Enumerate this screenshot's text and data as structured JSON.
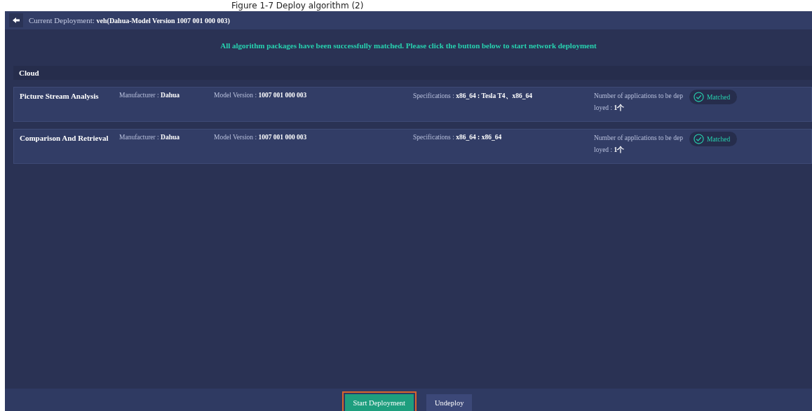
{
  "caption": "Figure 1-7 Deploy algorithm (2)",
  "header": {
    "label": "Current Deployment:",
    "value": "veh(Dahua-Model Version 1007 001 000 003)"
  },
  "message": "All algorithm packages have been successfully matched. Please click the button below to start network deployment",
  "section": {
    "title": "Cloud"
  },
  "rows": [
    {
      "name": "Picture Stream Analysis",
      "manufacturer_label": "Manufacturer :",
      "manufacturer": "Dahua",
      "model_label": "Model Version :",
      "model": "1007 001 000 003",
      "spec_label": "Specifications :",
      "spec": "x86_64 : Tesla T4、x86_64",
      "count_label": "Number of applications to be deployed :",
      "count": "1个",
      "status": "Matched",
      "matched": true
    },
    {
      "name": "Comparison And Retrieval",
      "manufacturer_label": "Manufacturer :",
      "manufacturer": "Dahua",
      "model_label": "Model Version :",
      "model": "1007 001 000 003",
      "spec_label": "Specifications :",
      "spec": "x86_64 : x86_64",
      "count_label": "Number of applications to be deployed :",
      "count": "1个",
      "status": "Matched",
      "matched": true
    }
  ],
  "buttons": [
    {
      "label": "Start Deployment",
      "kind": "primary",
      "highlighted": true
    },
    {
      "label": "Undeploy",
      "kind": "secondary",
      "highlighted": false
    }
  ]
}
